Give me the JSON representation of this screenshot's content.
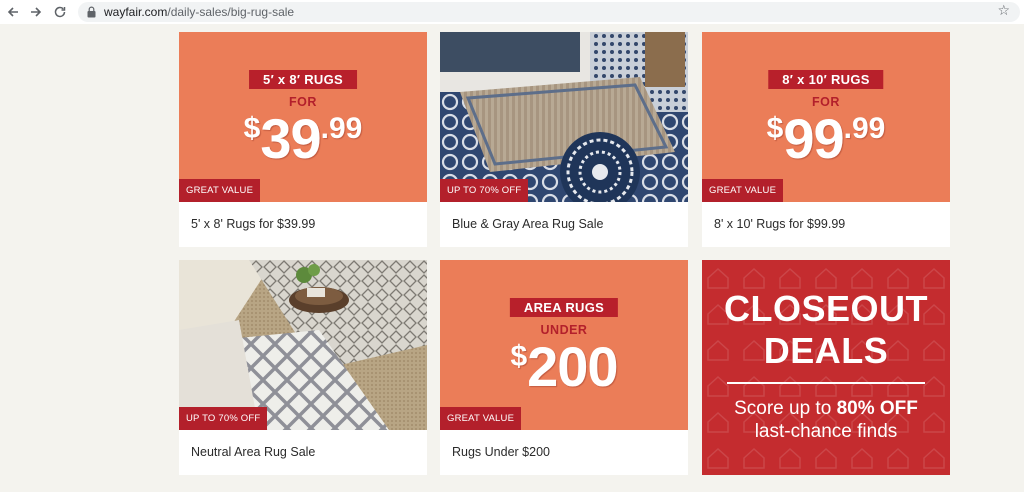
{
  "browser": {
    "back_icon": "back-arrow-icon",
    "forward_icon": "forward-arrow-icon",
    "reload_icon": "reload-icon",
    "url_domain": "wayfair.com",
    "url_path": "/daily-sales/big-rug-sale",
    "bookmark_icon": "star-icon"
  },
  "cards": [
    {
      "banner": "5′ x 8′ RUGS",
      "for_text": "FOR",
      "price": {
        "symbol": "$",
        "main": "39",
        "cents": ".99"
      },
      "badge": "GREAT VALUE",
      "caption": "5' x 8' Rugs for $39.99"
    },
    {
      "badge": "UP TO 70% OFF",
      "caption": "Blue & Gray Area Rug Sale"
    },
    {
      "banner": "8′ x 10′ RUGS",
      "for_text": "FOR",
      "price": {
        "symbol": "$",
        "main": "99",
        "cents": ".99"
      },
      "badge": "GREAT VALUE",
      "caption": "8' x 10' Rugs for $99.99"
    },
    {
      "badge": "UP TO 70% OFF",
      "caption": "Neutral Area Rug Sale"
    },
    {
      "banner": "AREA RUGS",
      "for_text": "UNDER",
      "price": {
        "symbol": "$",
        "main": "200",
        "cents": ""
      },
      "badge": "GREAT VALUE",
      "caption": "Rugs Under $200"
    }
  ],
  "closeout": {
    "line1": "CLOSEOUT",
    "line2": "DEALS",
    "sub_pre": "Score up to ",
    "sub_bold": "80% OFF",
    "sub2": "last-chance finds"
  },
  "colors": {
    "promo_orange": "#eb7d58",
    "accent_red": "#b8202b",
    "closeout_red": "#c42c2f"
  }
}
